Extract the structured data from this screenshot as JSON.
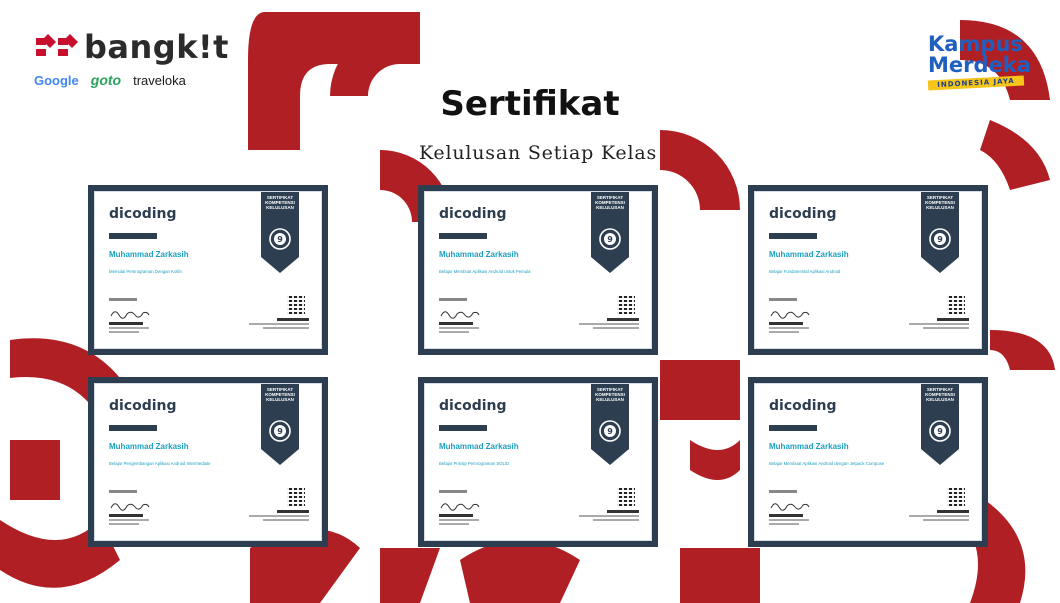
{
  "header": {
    "bangkit_logo": "bangk!t",
    "partners": [
      "Google",
      "goto",
      "traveloka"
    ],
    "kampus_merdeka": {
      "line1": "Kampus",
      "line2": "Merdeka",
      "ribbon": "INDONESIA JAYA"
    }
  },
  "title": "Sertifikat",
  "subtitle": "Kelulusan Setiap Kelas",
  "colors": {
    "accent_red": "#b01f24",
    "cert_frame": "#2d3e50",
    "name_teal": "#1a9fc0"
  },
  "certificates": [
    {
      "brand": "dicoding",
      "ribbon": [
        "SERTIFIKAT",
        "KOMPETENSI",
        "KELULUSAN"
      ],
      "recipient": "Muhammad Zarkasih",
      "course": "Memulai Pemrograman Dengan Kotlin"
    },
    {
      "brand": "dicoding",
      "ribbon": [
        "SERTIFIKAT",
        "KOMPETENSI",
        "KELULUSAN"
      ],
      "recipient": "Muhammad Zarkasih",
      "course": "Belajar Membuat Aplikasi Android untuk Pemula"
    },
    {
      "brand": "dicoding",
      "ribbon": [
        "SERTIFIKAT",
        "KOMPETENSI",
        "KELULUSAN"
      ],
      "recipient": "Muhammad Zarkasih",
      "course": "Belajar Fundamental Aplikasi Android"
    },
    {
      "brand": "dicoding",
      "ribbon": [
        "SERTIFIKAT",
        "KOMPETENSI",
        "KELULUSAN"
      ],
      "recipient": "Muhammad Zarkasih",
      "course": "Belajar Pengembangan Aplikasi Android Intermediate"
    },
    {
      "brand": "dicoding",
      "ribbon": [
        "SERTIFIKAT",
        "KOMPETENSI",
        "KELULUSAN"
      ],
      "recipient": "Muhammad Zarkasih",
      "course": "Belajar Prinsip Pemrograman SOLID"
    },
    {
      "brand": "dicoding",
      "ribbon": [
        "SERTIFIKAT",
        "KOMPETENSI",
        "KELULUSAN"
      ],
      "recipient": "Muhammad Zarkasih",
      "course": "Belajar Membuat Aplikasi Android dengan Jetpack Compose"
    }
  ]
}
